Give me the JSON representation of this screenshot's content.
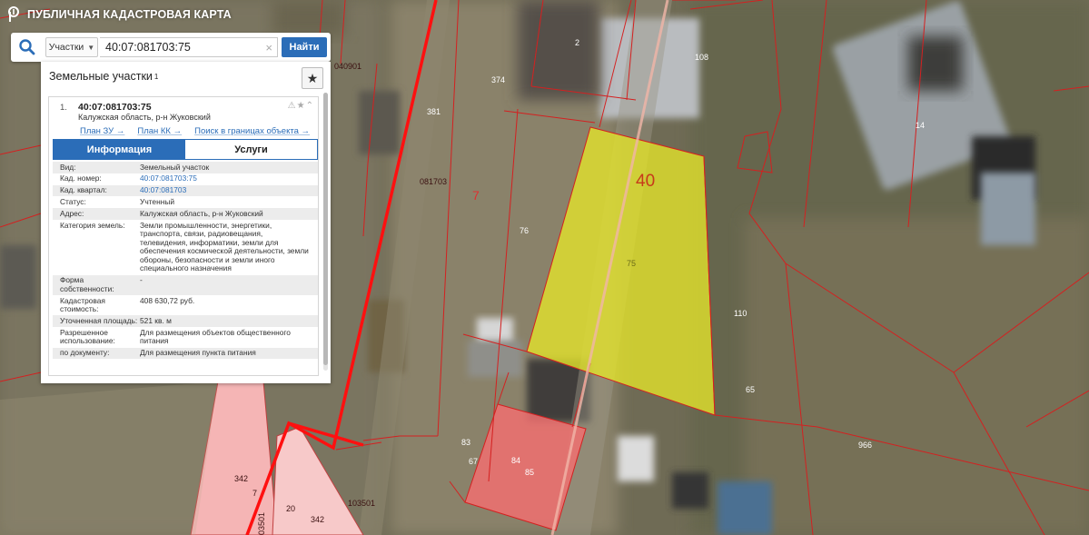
{
  "app": {
    "title": "ПУБЛИЧНАЯ КАДАСТРОВАЯ КАРТА"
  },
  "search": {
    "type_label": "Участки",
    "query": "40:07:081703:75",
    "find_label": "Найти"
  },
  "panel": {
    "title": "Земельные участки",
    "count_sup": "1",
    "item": {
      "index": "1.",
      "cadastral_number": "40:07:081703:75",
      "address": "Калужская область, р-н Жуковский",
      "links": [
        "План ЗУ →",
        "План КК →",
        "Поиск в границах объекта →"
      ],
      "tabs": [
        "Информация",
        "Услуги"
      ],
      "active_tab": "Информация",
      "fields": [
        {
          "key": "Вид:",
          "value": "Земельный участок"
        },
        {
          "key": "Кад. номер:",
          "value": "40:07:081703:75",
          "link": true
        },
        {
          "key": "Кад. квартал:",
          "value": "40:07:081703",
          "link": true
        },
        {
          "key": "Статус:",
          "value": "Учтенный"
        },
        {
          "key": "Адрес:",
          "value": "Калужская область, р-н Жуковский"
        },
        {
          "key": "Категория земель:",
          "value": "Земли промышленности, энергетики, транспорта, связи, радиовещания, телевидения, информатики, земли для обеспечения космической деятельности, земли обороны, безопасности и земли иного специального назначения"
        },
        {
          "key": "Форма собственности:",
          "value": "-"
        },
        {
          "key": "Кадастровая стоимость:",
          "value": "408 630,72 руб."
        },
        {
          "key": "Уточненная площадь:",
          "value": "521 кв. м"
        },
        {
          "key": "Разрешенное использование:",
          "value": "Для размещения объектов общественного питания"
        },
        {
          "key": "по документу:",
          "value": "Для размещения пункта питания"
        }
      ]
    }
  },
  "map_labels": {
    "q_040901": "040901",
    "q_081703": "081703",
    "q_103501": "103501",
    "q_103501_vert": "03501",
    "selected_number": "40",
    "selected_parcel": "75",
    "p2": "2",
    "p108": "108",
    "p374": "374",
    "p381": "381",
    "p14": "14",
    "p7a": "7",
    "p76": "76",
    "p110": "110",
    "p65": "65",
    "p966": "966",
    "p83": "83",
    "p67": "67",
    "p84": "84",
    "p85": "85",
    "p342a": "342",
    "p7b": "7",
    "p20": "20",
    "p342b": "342"
  },
  "colors": {
    "accent": "#2b6db8",
    "selected_fill": "#e6e62a",
    "parcel_line": "#d42020",
    "pink_parcel": "#f07070"
  }
}
